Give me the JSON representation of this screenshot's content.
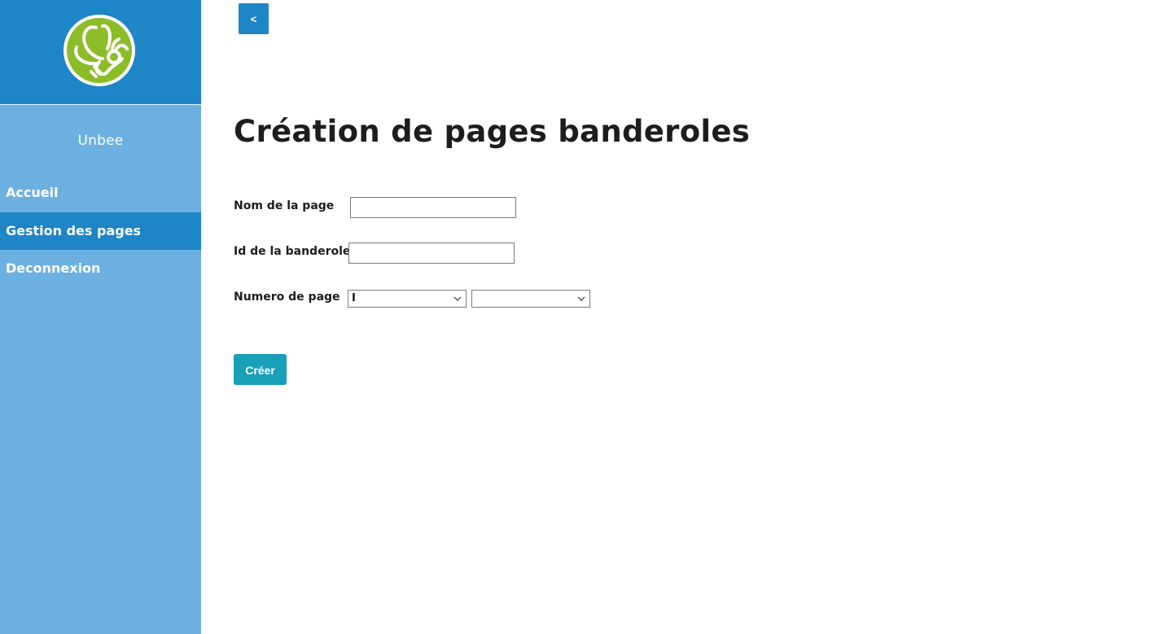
{
  "sidebar": {
    "brand": "Unbee",
    "items": [
      {
        "label": "Accueil",
        "active": false
      },
      {
        "label": "Gestion des pages",
        "active": true
      },
      {
        "label": "Deconnexion",
        "active": false
      }
    ]
  },
  "header": {
    "back_label": "<"
  },
  "main": {
    "title": "Création de pages banderoles",
    "form": {
      "page_name_label": "Nom de la page",
      "page_name_value": "",
      "banner_id_label": "Id de la banderole",
      "banner_id_value": "",
      "page_number_label": "Numero de page",
      "page_number_select_1": "I",
      "page_number_select_2": "",
      "submit_label": "Créer"
    }
  },
  "colors": {
    "sidebar_header": "#1e85c6",
    "sidebar_bg": "#6cb0e2",
    "active_item": "#1e85c6",
    "logo_green": "#8cbd28",
    "submit_button": "#18a0b9"
  },
  "icons": {
    "logo": "bee-logo-icon",
    "select_arrow": "chevron-down-icon"
  }
}
